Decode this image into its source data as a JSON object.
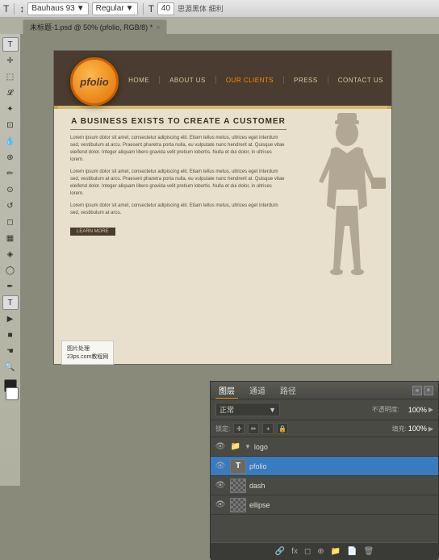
{
  "toolbar": {
    "text_tool": "T",
    "size_icon": "↕",
    "font_family": "Bauhaus 93",
    "font_style": "Regular",
    "text_tool2": "T",
    "font_size": "40",
    "extra_text": "思源黑体 细利"
  },
  "tab": {
    "filename": "未标题-1.psd @ 50% (pfolio, RGB/8) *",
    "close": "×"
  },
  "website": {
    "logo": "pfolio",
    "nav_items": [
      "HOME",
      "ABOUT US",
      "OUR CLIENTS",
      "PRESS",
      "CONTACT US"
    ],
    "headline": "A BUSINESS EXISTS TO CREATE A CUSTOMER",
    "paragraphs": [
      "Lorem ipsum dolor sit amet, consectetur adipiscing elit. Etiam tellus metus, ultrices eget interdum sed, vestibulum at arcu. Praesent pharetra porta nulla, eu vulputate nunc hendrerit at. Quisque vitae eleifend dolor. Integer aliquam libero gravida velit pretium lobortis. Nulla et dui dolor, in ultrices lorem.",
      "Lorem ipsum dolor sit amet, consectetur adipiscing elit. Etiam tellus metus, ultrices eget interdum sed, vestibulum at arcu. Praesent pharetra porta nulla, eu vulputate nunc hendrerit at. Quisque vitae eleifend dolor. Integer aliquam libero gravida velit pretium lobortis. Nulla et dui dolor, in ultrices lorem.",
      "Lorem ipsum dolor sit amet, consectetur adipiscing elit. Etiam tellus metus, ultrices eget interdum sed, vestibulum at arcu."
    ],
    "cta_button": "LEARN MORE"
  },
  "watermark": {
    "line1": "图片处理",
    "line2": "23ps.com教程网"
  },
  "layers_panel": {
    "title": "图层",
    "tabs": [
      "图层",
      "通道",
      "路径"
    ],
    "blend_mode": "正常",
    "opacity_label": "不透明度:",
    "opacity_value": "100%",
    "lock_label": "锁定:",
    "fill_label": "填充:",
    "fill_value": "100%",
    "layers": [
      {
        "name": "logo",
        "type": "folder",
        "visible": true,
        "selected": false
      },
      {
        "name": "pfolio",
        "type": "text",
        "visible": true,
        "selected": true
      },
      {
        "name": "dash",
        "type": "checker",
        "visible": true,
        "selected": false
      },
      {
        "name": "ellipse",
        "type": "checker",
        "visible": true,
        "selected": false
      }
    ],
    "bottom_icons": [
      "fx",
      "◻",
      "📋",
      "🗑"
    ]
  }
}
